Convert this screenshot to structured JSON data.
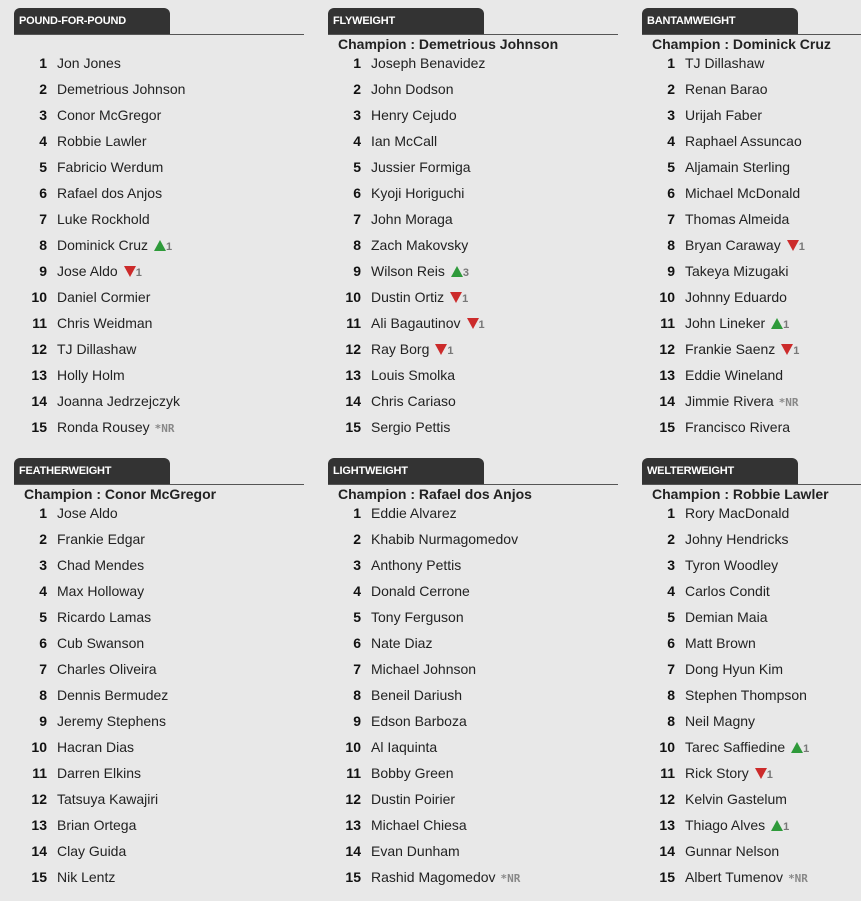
{
  "colors": {
    "up": "#2e9a3a",
    "down": "#cc2b2b",
    "tab": "#333333"
  },
  "divisions": [
    {
      "title": "POUND-FOR-POUND",
      "champion": null,
      "fighters": [
        {
          "rank": "1",
          "name": "Jon Jones"
        },
        {
          "rank": "2",
          "name": "Demetrious Johnson"
        },
        {
          "rank": "3",
          "name": "Conor McGregor"
        },
        {
          "rank": "4",
          "name": "Robbie Lawler"
        },
        {
          "rank": "5",
          "name": "Fabricio Werdum"
        },
        {
          "rank": "6",
          "name": "Rafael dos Anjos"
        },
        {
          "rank": "7",
          "name": "Luke Rockhold"
        },
        {
          "rank": "8",
          "name": "Dominick Cruz",
          "move": "up",
          "delta": "1"
        },
        {
          "rank": "9",
          "name": "Jose Aldo",
          "move": "down",
          "delta": "1"
        },
        {
          "rank": "10",
          "name": "Daniel Cormier"
        },
        {
          "rank": "11",
          "name": "Chris Weidman"
        },
        {
          "rank": "12",
          "name": "TJ Dillashaw"
        },
        {
          "rank": "13",
          "name": "Holly Holm"
        },
        {
          "rank": "14",
          "name": "Joanna Jedrzejczyk"
        },
        {
          "rank": "15",
          "name": "Ronda Rousey",
          "nr": "*NR"
        }
      ]
    },
    {
      "title": "FLYWEIGHT",
      "champion": "Champion : Demetrious Johnson",
      "fighters": [
        {
          "rank": "1",
          "name": "Joseph Benavidez"
        },
        {
          "rank": "2",
          "name": "John Dodson"
        },
        {
          "rank": "3",
          "name": "Henry Cejudo"
        },
        {
          "rank": "4",
          "name": "Ian McCall"
        },
        {
          "rank": "5",
          "name": "Jussier Formiga"
        },
        {
          "rank": "6",
          "name": "Kyoji Horiguchi"
        },
        {
          "rank": "7",
          "name": "John Moraga"
        },
        {
          "rank": "8",
          "name": "Zach Makovsky"
        },
        {
          "rank": "9",
          "name": "Wilson Reis",
          "move": "up",
          "delta": "3"
        },
        {
          "rank": "10",
          "name": "Dustin Ortiz",
          "move": "down",
          "delta": "1"
        },
        {
          "rank": "11",
          "name": "Ali Bagautinov",
          "move": "down",
          "delta": "1"
        },
        {
          "rank": "12",
          "name": "Ray Borg",
          "move": "down",
          "delta": "1"
        },
        {
          "rank": "13",
          "name": "Louis Smolka"
        },
        {
          "rank": "14",
          "name": "Chris Cariaso"
        },
        {
          "rank": "15",
          "name": "Sergio Pettis"
        }
      ]
    },
    {
      "title": "BANTAMWEIGHT",
      "champion": "Champion : Dominick Cruz",
      "fighters": [
        {
          "rank": "1",
          "name": "TJ Dillashaw"
        },
        {
          "rank": "2",
          "name": "Renan Barao"
        },
        {
          "rank": "3",
          "name": "Urijah Faber"
        },
        {
          "rank": "4",
          "name": "Raphael Assuncao"
        },
        {
          "rank": "5",
          "name": "Aljamain Sterling"
        },
        {
          "rank": "6",
          "name": "Michael McDonald"
        },
        {
          "rank": "7",
          "name": "Thomas Almeida"
        },
        {
          "rank": "8",
          "name": "Bryan Caraway",
          "move": "down",
          "delta": "1"
        },
        {
          "rank": "9",
          "name": "Takeya Mizugaki"
        },
        {
          "rank": "10",
          "name": "Johnny Eduardo"
        },
        {
          "rank": "11",
          "name": "John Lineker",
          "move": "up",
          "delta": "1"
        },
        {
          "rank": "12",
          "name": "Frankie Saenz",
          "move": "down",
          "delta": "1"
        },
        {
          "rank": "13",
          "name": "Eddie Wineland"
        },
        {
          "rank": "14",
          "name": "Jimmie Rivera",
          "nr": "*NR"
        },
        {
          "rank": "15",
          "name": "Francisco Rivera"
        }
      ]
    },
    {
      "title": "FEATHERWEIGHT",
      "champion": "Champion : Conor McGregor",
      "fighters": [
        {
          "rank": "1",
          "name": "Jose Aldo"
        },
        {
          "rank": "2",
          "name": "Frankie Edgar"
        },
        {
          "rank": "3",
          "name": "Chad Mendes"
        },
        {
          "rank": "4",
          "name": "Max Holloway"
        },
        {
          "rank": "5",
          "name": "Ricardo Lamas"
        },
        {
          "rank": "6",
          "name": "Cub Swanson"
        },
        {
          "rank": "7",
          "name": "Charles Oliveira"
        },
        {
          "rank": "8",
          "name": "Dennis Bermudez"
        },
        {
          "rank": "9",
          "name": "Jeremy Stephens"
        },
        {
          "rank": "10",
          "name": "Hacran Dias"
        },
        {
          "rank": "11",
          "name": "Darren Elkins"
        },
        {
          "rank": "12",
          "name": "Tatsuya Kawajiri"
        },
        {
          "rank": "13",
          "name": "Brian Ortega"
        },
        {
          "rank": "14",
          "name": "Clay Guida"
        },
        {
          "rank": "15",
          "name": "Nik Lentz"
        }
      ]
    },
    {
      "title": "LIGHTWEIGHT",
      "champion": "Champion : Rafael dos Anjos",
      "fighters": [
        {
          "rank": "1",
          "name": "Eddie Alvarez"
        },
        {
          "rank": "2",
          "name": "Khabib Nurmagomedov"
        },
        {
          "rank": "3",
          "name": "Anthony Pettis"
        },
        {
          "rank": "4",
          "name": "Donald Cerrone"
        },
        {
          "rank": "5",
          "name": "Tony Ferguson"
        },
        {
          "rank": "6",
          "name": "Nate Diaz"
        },
        {
          "rank": "7",
          "name": "Michael Johnson"
        },
        {
          "rank": "8",
          "name": "Beneil Dariush"
        },
        {
          "rank": "9",
          "name": "Edson Barboza"
        },
        {
          "rank": "10",
          "name": "Al Iaquinta"
        },
        {
          "rank": "11",
          "name": "Bobby Green"
        },
        {
          "rank": "12",
          "name": "Dustin Poirier"
        },
        {
          "rank": "13",
          "name": "Michael Chiesa"
        },
        {
          "rank": "14",
          "name": "Evan Dunham"
        },
        {
          "rank": "15",
          "name": "Rashid Magomedov",
          "nr": "*NR"
        }
      ]
    },
    {
      "title": "WELTERWEIGHT",
      "champion": "Champion : Robbie Lawler",
      "fighters": [
        {
          "rank": "1",
          "name": "Rory MacDonald"
        },
        {
          "rank": "2",
          "name": "Johny Hendricks"
        },
        {
          "rank": "3",
          "name": "Tyron Woodley"
        },
        {
          "rank": "4",
          "name": "Carlos Condit"
        },
        {
          "rank": "5",
          "name": "Demian Maia"
        },
        {
          "rank": "6",
          "name": "Matt Brown"
        },
        {
          "rank": "7",
          "name": "Dong Hyun Kim"
        },
        {
          "rank": "8",
          "name": "Stephen Thompson"
        },
        {
          "rank": "8",
          "name": "Neil Magny"
        },
        {
          "rank": "10",
          "name": "Tarec Saffiedine",
          "move": "up",
          "delta": "1"
        },
        {
          "rank": "11",
          "name": "Rick Story",
          "move": "down",
          "delta": "1"
        },
        {
          "rank": "12",
          "name": "Kelvin Gastelum"
        },
        {
          "rank": "13",
          "name": "Thiago Alves",
          "move": "up",
          "delta": "1"
        },
        {
          "rank": "14",
          "name": "Gunnar Nelson"
        },
        {
          "rank": "15",
          "name": "Albert Tumenov",
          "nr": "*NR"
        }
      ]
    }
  ]
}
